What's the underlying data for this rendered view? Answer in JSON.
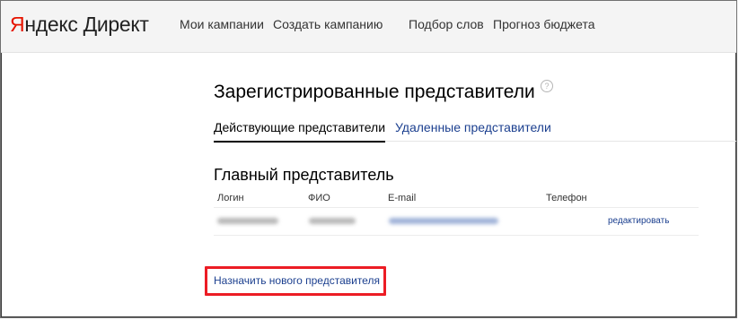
{
  "header": {
    "logo": {
      "first_letter": "Я",
      "brand_rest": "ндекс",
      "product": "Директ"
    },
    "nav": [
      {
        "label": "Мои кампании"
      },
      {
        "label": "Создать кампанию"
      },
      {
        "label": "Подбор слов"
      },
      {
        "label": "Прогноз бюджета"
      }
    ]
  },
  "page": {
    "title": "Зарегистрированные представители",
    "help_glyph": "?",
    "tabs": [
      {
        "label": "Действующие представители",
        "active": true
      },
      {
        "label": "Удаленные представители",
        "active": false
      }
    ]
  },
  "main_rep": {
    "section_title": "Главный представитель",
    "columns": [
      "Логин",
      "ФИО",
      "E-mail",
      "Телефон"
    ],
    "row": {
      "login": "",
      "fio": "",
      "email": "",
      "phone": "",
      "action_label": "редактировать"
    }
  },
  "actions": {
    "assign_label": "Назначить нового представителя"
  },
  "colors": {
    "brand_red": "#e61400",
    "link_blue": "#1b3f8f",
    "highlight_red": "#ec1c24",
    "header_bg": "#f4f4f4"
  }
}
